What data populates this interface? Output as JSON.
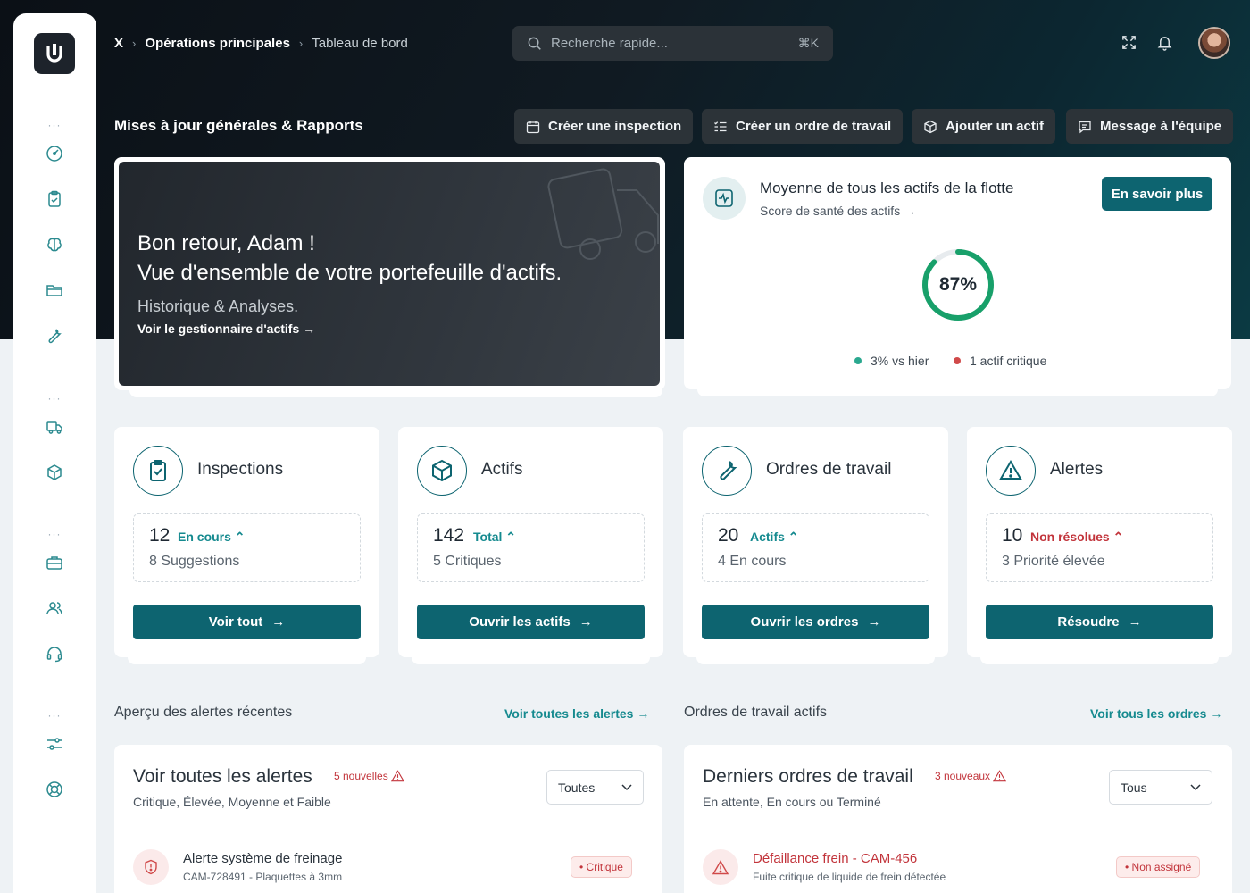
{
  "breadcrumb": {
    "root": "X",
    "section": "Opérations principales",
    "page": "Tableau de bord"
  },
  "search": {
    "placeholder": "Recherche rapide...",
    "shortcut": "⌘K"
  },
  "header": {
    "title": "Mises à jour générales & Rapports",
    "actions": [
      {
        "label": "Créer une inspection",
        "icon": "calendar-icon"
      },
      {
        "label": "Créer un ordre de travail",
        "icon": "checklist-icon"
      },
      {
        "label": "Ajouter un actif",
        "icon": "box-plus-icon"
      },
      {
        "label": "Message à l'équipe",
        "icon": "message-icon"
      }
    ]
  },
  "welcome": {
    "line1": "Bon retour, Adam !",
    "line2": "Vue d'ensemble de votre portefeuille d'actifs.",
    "subtitle": "Historique & Analyses.",
    "link": "Voir le gestionnaire d'actifs"
  },
  "health": {
    "title": "Moyenne de tous les actifs de la flotte",
    "subtitle": "Score de santé des actifs",
    "button": "En savoir plus",
    "score_label": "87%",
    "score": 0.87,
    "legend": [
      {
        "label": "3% vs hier",
        "color": "#2aa88f"
      },
      {
        "label": "1 actif critique",
        "color": "#d04a4a"
      }
    ]
  },
  "stats": [
    {
      "title": "Inspections",
      "icon": "clipboard-check-icon",
      "value": "12",
      "tag": "En cours",
      "tag_color": "#158a8f",
      "sub": "8 Suggestions",
      "button": "Voir tout"
    },
    {
      "title": "Actifs",
      "icon": "cube-icon",
      "value": "142",
      "tag": "Total",
      "tag_color": "#158a8f",
      "sub": "5 Critiques",
      "button": "Ouvrir les actifs"
    },
    {
      "title": "Ordres de travail",
      "icon": "wrench-icon",
      "value": "20",
      "tag": "Actifs",
      "tag_color": "#158a8f",
      "sub": "4 En cours",
      "button": "Ouvrir les ordres"
    },
    {
      "title": "Alertes",
      "icon": "warning-icon",
      "value": "10",
      "tag": "Non résolues",
      "tag_color": "#c2343b",
      "sub": "3 Priorité élevée",
      "button": "Résoudre"
    }
  ],
  "alerts_section": {
    "heading": "Aperçu des alertes récentes",
    "link": "Voir toutes les alertes",
    "panel_title": "Voir toutes les alertes",
    "badge": "5 nouvelles",
    "subtitle": "Critique, Élevée, Moyenne et Faible",
    "filter": "Toutes",
    "row": {
      "title": "Alerte système de freinage",
      "sub": "CAM-728491 - Plaquettes à 3mm",
      "status": "• Critique"
    }
  },
  "orders_section": {
    "heading": "Ordres de travail actifs",
    "link": "Voir tous les ordres",
    "panel_title": "Derniers ordres de travail",
    "badge": "3 nouveaux",
    "subtitle": "En attente, En cours ou Terminé",
    "filter": "Tous",
    "row": {
      "title": "Défaillance frein - CAM-456",
      "sub": "Fuite critique de liquide de frein détectée",
      "status": "• Non assigné"
    }
  },
  "colors": {
    "primary": "#0d6470",
    "accent": "#158a8f",
    "danger": "#c2343b",
    "success": "#18a06a"
  },
  "sidebar": {
    "icons": [
      "dashboard-icon",
      "clipboard-icon",
      "brain-icon",
      "folder-icon",
      "wrench-icon",
      "truck-icon",
      "cube-icon",
      "briefcase-icon",
      "users-icon",
      "headset-icon",
      "sliders-icon",
      "lifebuoy-icon"
    ]
  }
}
